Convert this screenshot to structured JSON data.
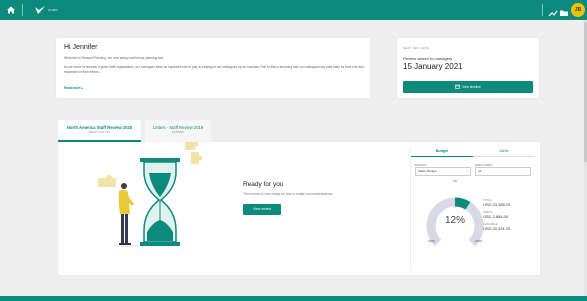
{
  "topbar": {
    "brand": "CURO",
    "user_initials": "JB",
    "icons": [
      "home-icon",
      "chart-icon",
      "folder-icon"
    ]
  },
  "welcome": {
    "greeting": "Hi Jennifer",
    "intro": "Welcome to Reward Planning, our new salary and bonus planning tool.",
    "body": "As we move to become a great Staff organisation, our managers have an important role to play in helping to set colleagues up for success. Part of this is ensuring that our colleagues are paid fairly for their role and rewarded for their efforts...",
    "read_more": "Read more ▸"
  },
  "key_date": {
    "label": "NEXT KEY DATE",
    "description": "Review closed to managers",
    "date": "15 January 2021",
    "button": "View timeline"
  },
  "tabs": [
    {
      "title": "North America Staff Review 2020",
      "subtitle": "READY FOR YOU"
    },
    {
      "title": "Letters - Staff Review 2019",
      "subtitle": "LETTERS"
    }
  ],
  "review": {
    "title": "Ready for you",
    "description": "This review is now ready for you to make recommendations.",
    "button": "View review"
  },
  "budget_panel": {
    "tabs": [
      "Budget",
      "Alerts"
    ],
    "budget_label": "BUDGET",
    "budget_value": "Salary Budget",
    "employees_label": "EMPLOYEES",
    "employees_value": "All",
    "gauge_top": "0%",
    "gauge_left": "100%",
    "gauge_right": "100%",
    "percent": "12%",
    "percent_value": 12,
    "total_label": "TOTAL",
    "total_value": "USD 23,385.29",
    "spent_label": "SPENT",
    "spent_value": "USD 2,884.00",
    "available_label": "AVAILABLE",
    "available_value": "USD 20,431.29"
  },
  "colors": {
    "brand": "#0e8a7c",
    "avatar": "#f2c200"
  }
}
